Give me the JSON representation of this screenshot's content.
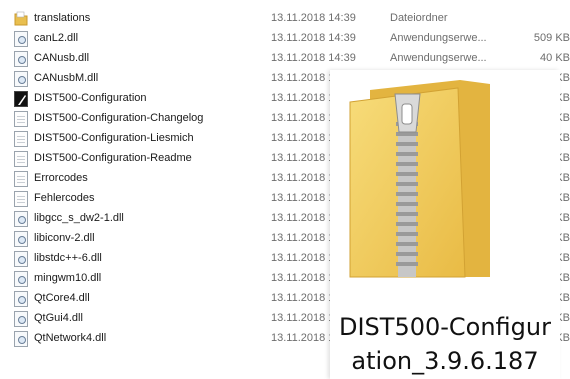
{
  "files": [
    {
      "name": "translations",
      "date": "13.11.2018 14:39",
      "type": "Dateiordner",
      "size": "",
      "icon": "folder-icon"
    },
    {
      "name": "canL2.dll",
      "date": "13.11.2018 14:39",
      "type": "Anwendungserwe...",
      "size": "509 KB",
      "icon": "dll-file-icon"
    },
    {
      "name": "CANusb.dll",
      "date": "13.11.2018 14:39",
      "type": "Anwendungserwe...",
      "size": "40 KB",
      "icon": "dll-file-icon"
    },
    {
      "name": "CANusbM.dll",
      "date": "13.11.2018 1",
      "type": "",
      "size": "KB",
      "icon": "dll-file-icon"
    },
    {
      "name": "DIST500-Configuration",
      "date": "13.11.2018 1",
      "type": "",
      "size": "KB",
      "icon": "application-icon"
    },
    {
      "name": "DIST500-Configuration-Changelog",
      "date": "13.11.2018 1",
      "type": "",
      "size": "KB",
      "icon": "text-file-icon"
    },
    {
      "name": "DIST500-Configuration-Liesmich",
      "date": "13.11.2018 1",
      "type": "",
      "size": "KB",
      "icon": "text-file-icon"
    },
    {
      "name": "DIST500-Configuration-Readme",
      "date": "13.11.2018 1",
      "type": "",
      "size": "KB",
      "icon": "text-file-icon"
    },
    {
      "name": "Errorcodes",
      "date": "13.11.2018 1",
      "type": "",
      "size": "KB",
      "icon": "text-file-icon"
    },
    {
      "name": "Fehlercodes",
      "date": "13.11.2018 1",
      "type": "",
      "size": "KB",
      "icon": "text-file-icon"
    },
    {
      "name": "libgcc_s_dw2-1.dll",
      "date": "13.11.2018 1",
      "type": "",
      "size": "KB",
      "icon": "dll-file-icon"
    },
    {
      "name": "libiconv-2.dll",
      "date": "13.11.2018 1",
      "type": "",
      "size": "KB",
      "icon": "dll-file-icon"
    },
    {
      "name": "libstdc++-6.dll",
      "date": "13.11.2018 1",
      "type": "",
      "size": "KB",
      "icon": "dll-file-icon"
    },
    {
      "name": "mingwm10.dll",
      "date": "13.11.2018 1",
      "type": "",
      "size": "KB",
      "icon": "dll-file-icon"
    },
    {
      "name": "QtCore4.dll",
      "date": "13.11.2018 1",
      "type": "",
      "size": "KB",
      "icon": "dll-file-icon"
    },
    {
      "name": "QtGui4.dll",
      "date": "13.11.2018 1",
      "type": "",
      "size": "KB",
      "icon": "dll-file-icon"
    },
    {
      "name": "QtNetwork4.dll",
      "date": "13.11.2018 1",
      "type": "",
      "size": "KB",
      "icon": "dll-file-icon"
    }
  ],
  "preview": {
    "label": "DIST500-Configuration_3.9.6.187",
    "icon": "zip-folder-icon",
    "colors": {
      "folder": "#f2cf62",
      "folder_dark": "#d9a93a",
      "zipper": "#b5b5b5"
    }
  }
}
